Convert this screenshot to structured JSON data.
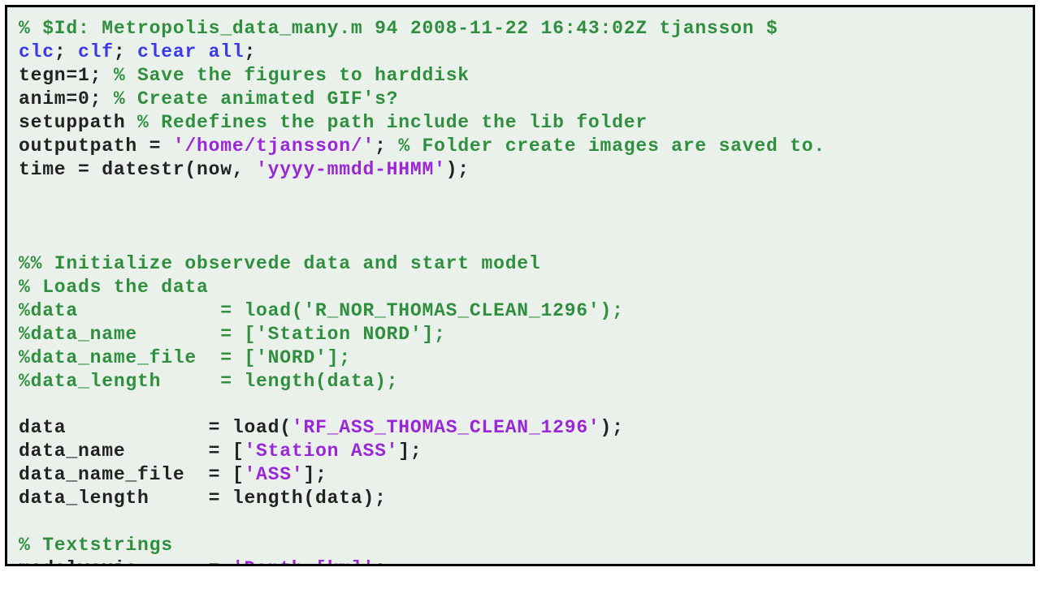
{
  "code": {
    "l1": {
      "comment": "% $Id: Metropolis_data_many.m 94 2008-11-22 16:43:02Z tjansson $"
    },
    "l2": {
      "kw1": "clc",
      "sep1": "; ",
      "kw2": "clf",
      "sep2": "; ",
      "kw3": "clear all",
      "sep3": ";"
    },
    "l3": {
      "code": "tegn=1; ",
      "comment": "% Save the figures to harddisk"
    },
    "l4": {
      "code": "anim=0; ",
      "comment": "% Create animated GIF's?"
    },
    "l5": {
      "code": "setuppath ",
      "comment": "% Redefines the path include the lib folder"
    },
    "l6": {
      "code1": "outputpath = ",
      "str": "'/home/tjansson/'",
      "code2": "; ",
      "comment": "% Folder create images are saved to."
    },
    "l7": {
      "code1": "time = datestr(now, ",
      "str": "'yyyy-mmdd-HHMM'",
      "code2": ");"
    },
    "l8": {
      "comment": "%% Initialize observede data and start model"
    },
    "l9": {
      "comment": "% Loads the data"
    },
    "l10": {
      "comment": "%data            = load('R_NOR_THOMAS_CLEAN_1296');"
    },
    "l11": {
      "comment": "%data_name       = ['Station NORD'];"
    },
    "l12": {
      "comment": "%data_name_file  = ['NORD'];"
    },
    "l13": {
      "comment": "%data_length     = length(data);"
    },
    "l14": {
      "code1": "data            = load(",
      "str": "'RF_ASS_THOMAS_CLEAN_1296'",
      "code2": ");"
    },
    "l15": {
      "code1": "data_name       = [",
      "str": "'Station ASS'",
      "code2": "];"
    },
    "l16": {
      "code1": "data_name_file  = [",
      "str": "'ASS'",
      "code2": "];"
    },
    "l17": {
      "code": "data_length     = length(data);"
    },
    "l18": {
      "comment": "% Textstrings"
    },
    "l19": {
      "code1": "modelyaxis      = ",
      "str": "'Depth [km]'",
      "code2": ";"
    }
  }
}
